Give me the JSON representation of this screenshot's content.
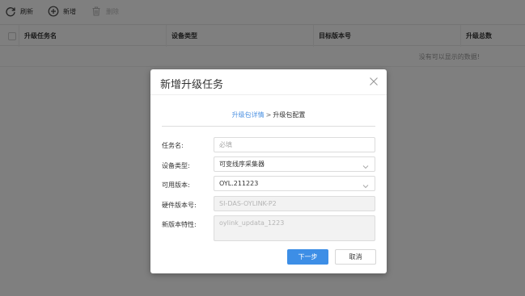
{
  "toolbar": {
    "refresh_label": "刷新",
    "add_label": "新增",
    "delete_label": "删除"
  },
  "table": {
    "columns": [
      "升级任务名",
      "设备类型",
      "目标版本号",
      "升级总数"
    ],
    "empty_text": "没有可以显示的数据!"
  },
  "dialog": {
    "title": "新增升级任务",
    "steps": {
      "current": "升级包详情",
      "separator": ">",
      "next": "升级包配置"
    },
    "fields": {
      "task_name_label": "任务名:",
      "task_name_placeholder": "必填",
      "device_type_label": "设备类型:",
      "device_type_value": "可变线序采集器",
      "available_version_label": "可用版本:",
      "available_version_value": "OYL.211223",
      "hardware_version_label": "硬件版本号:",
      "hardware_version_value": "SI-DAS-OYLINK-P2",
      "new_features_label": "新版本特性:",
      "new_features_value": "oylink_updata_1223"
    },
    "buttons": {
      "next_label": "下一步",
      "cancel_label": "取消"
    }
  },
  "colors": {
    "primary": "#3d8ee6",
    "step_active": "#4a90e2",
    "overlay": "rgba(0,0,0,0.5)"
  }
}
